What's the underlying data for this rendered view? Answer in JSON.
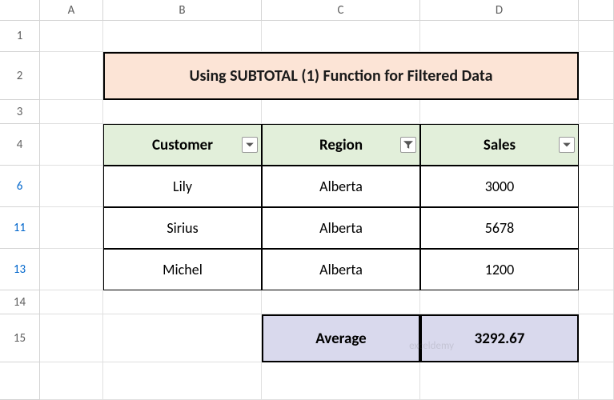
{
  "columns": [
    "A",
    "B",
    "C",
    "D"
  ],
  "rows": [
    "1",
    "2",
    "3",
    "4",
    "6",
    "11",
    "13",
    "14",
    "15"
  ],
  "filteredRows": [
    "6",
    "11",
    "13"
  ],
  "title": "Using SUBTOTAL (1)  Function for Filtered Data",
  "table": {
    "headers": {
      "customer": "Customer",
      "region": "Region",
      "sales": "Sales"
    },
    "data": [
      {
        "customer": "Lily",
        "region": "Alberta",
        "sales": "3000"
      },
      {
        "customer": "Sirius",
        "region": "Alberta",
        "sales": "5678"
      },
      {
        "customer": "Michel",
        "region": "Alberta",
        "sales": "1200"
      }
    ]
  },
  "summary": {
    "label": "Average",
    "value": "3292.67"
  },
  "watermark": "exceldemy"
}
